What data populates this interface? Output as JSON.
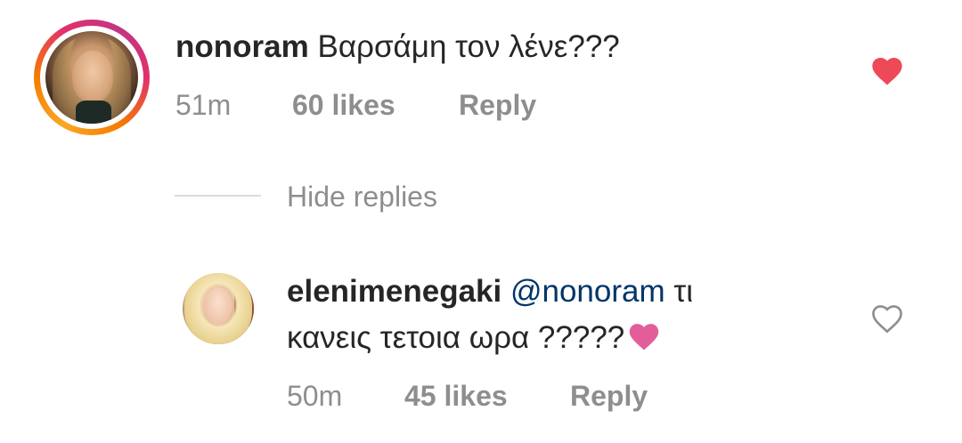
{
  "comment": {
    "username": "nonoram",
    "text": "Βαρσάμη τον λένε???",
    "time": "51m",
    "likes": "60 likes",
    "reply_label": "Reply",
    "liked": true,
    "heart_color": "#ed4956"
  },
  "hide_replies_label": "Hide replies",
  "reply": {
    "username": "elenimenegaki",
    "mention": "@nonoram",
    "text_line1": "τι",
    "text_line2": "κανεις τετοια ωρα ?????",
    "emoji": "pink-heart-emoji",
    "time": "50m",
    "likes": "45 likes",
    "reply_label": "Reply",
    "liked": false,
    "mention_color": "#003569"
  }
}
